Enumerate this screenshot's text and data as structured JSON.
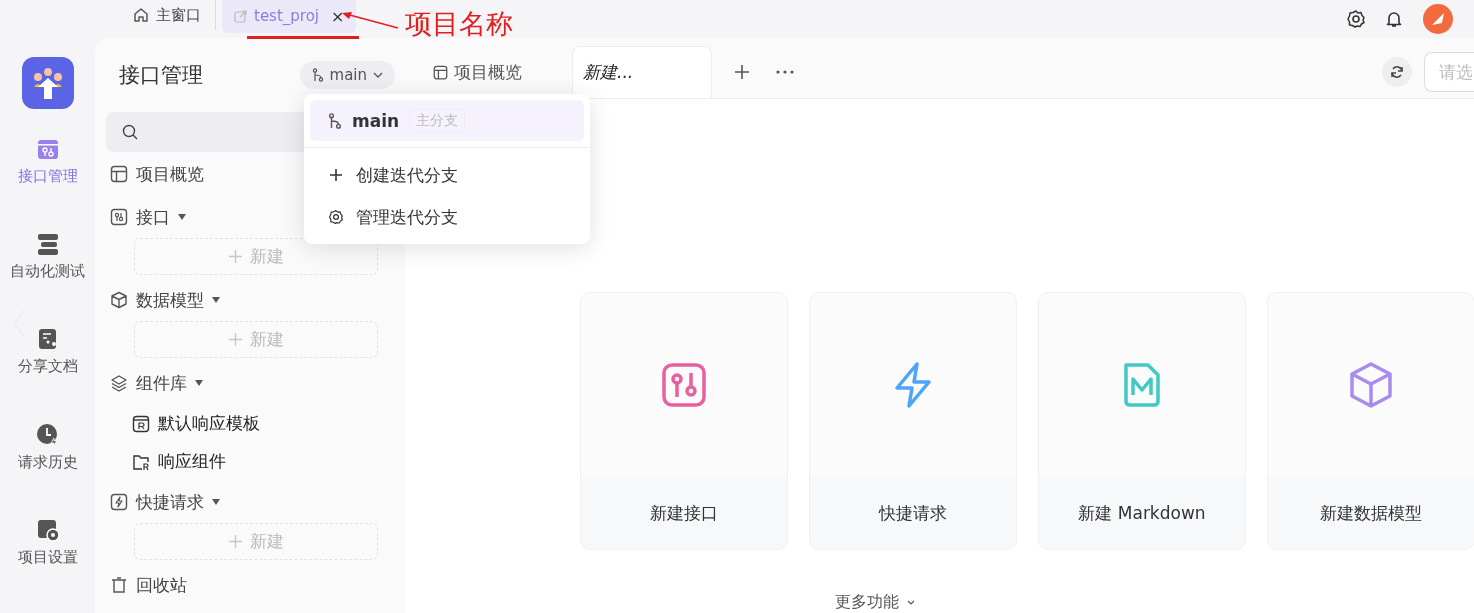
{
  "top_tabs": [
    {
      "label": "主窗口",
      "kind": "home",
      "selected": false,
      "closable": false
    },
    {
      "label": "test_proj",
      "kind": "project",
      "selected": true,
      "closable": true,
      "close": "×"
    }
  ],
  "annotation": {
    "text": "项目名称"
  },
  "rail": [
    {
      "label": "接口管理",
      "kind": "api",
      "selected": true
    },
    {
      "label": "自动化测试",
      "kind": "auto",
      "selected": false
    },
    {
      "label": "分享文档",
      "kind": "share",
      "selected": false
    },
    {
      "label": "请求历史",
      "kind": "history",
      "selected": false
    },
    {
      "label": "项目设置",
      "kind": "settings",
      "selected": false
    }
  ],
  "sidebar": {
    "title": "接口管理",
    "branch": "main",
    "items": [
      {
        "label": "项目概览",
        "kind": "overview"
      },
      {
        "label": "接口",
        "kind": "api",
        "expanded": true,
        "new": "新建"
      },
      {
        "label": "数据模型",
        "kind": "model",
        "expanded": true,
        "new": "新建"
      },
      {
        "label": "组件库",
        "kind": "lib",
        "expanded": true,
        "children": [
          {
            "label": "默认响应模板",
            "kind": "template"
          },
          {
            "label": "响应组件",
            "kind": "folder"
          }
        ]
      },
      {
        "label": "快捷请求",
        "kind": "quick",
        "expanded": true,
        "new": "新建"
      },
      {
        "label": "回收站",
        "kind": "trash"
      }
    ]
  },
  "branch_menu": {
    "current": {
      "label": "main",
      "tag": "主分支",
      "selected": true
    },
    "actions": [
      {
        "label": "创建迭代分支",
        "kind": "add"
      },
      {
        "label": "管理迭代分支",
        "kind": "gear"
      }
    ]
  },
  "tabs": [
    {
      "label": "项目概览",
      "kind": "overview",
      "selected": false
    },
    {
      "label": "新建...",
      "kind": "new",
      "selected": true
    }
  ],
  "search": {
    "placeholder": "请选"
  },
  "cards": [
    {
      "label": "新建接口",
      "kind": "api",
      "color": "#e8609f"
    },
    {
      "label": "快捷请求",
      "kind": "quick",
      "color": "#4ea4f7"
    },
    {
      "label": "新建 Markdown",
      "kind": "md",
      "color": "#3fcac4"
    },
    {
      "label": "新建数据模型",
      "kind": "model",
      "color": "#a98bf0"
    }
  ],
  "more": "更多功能"
}
